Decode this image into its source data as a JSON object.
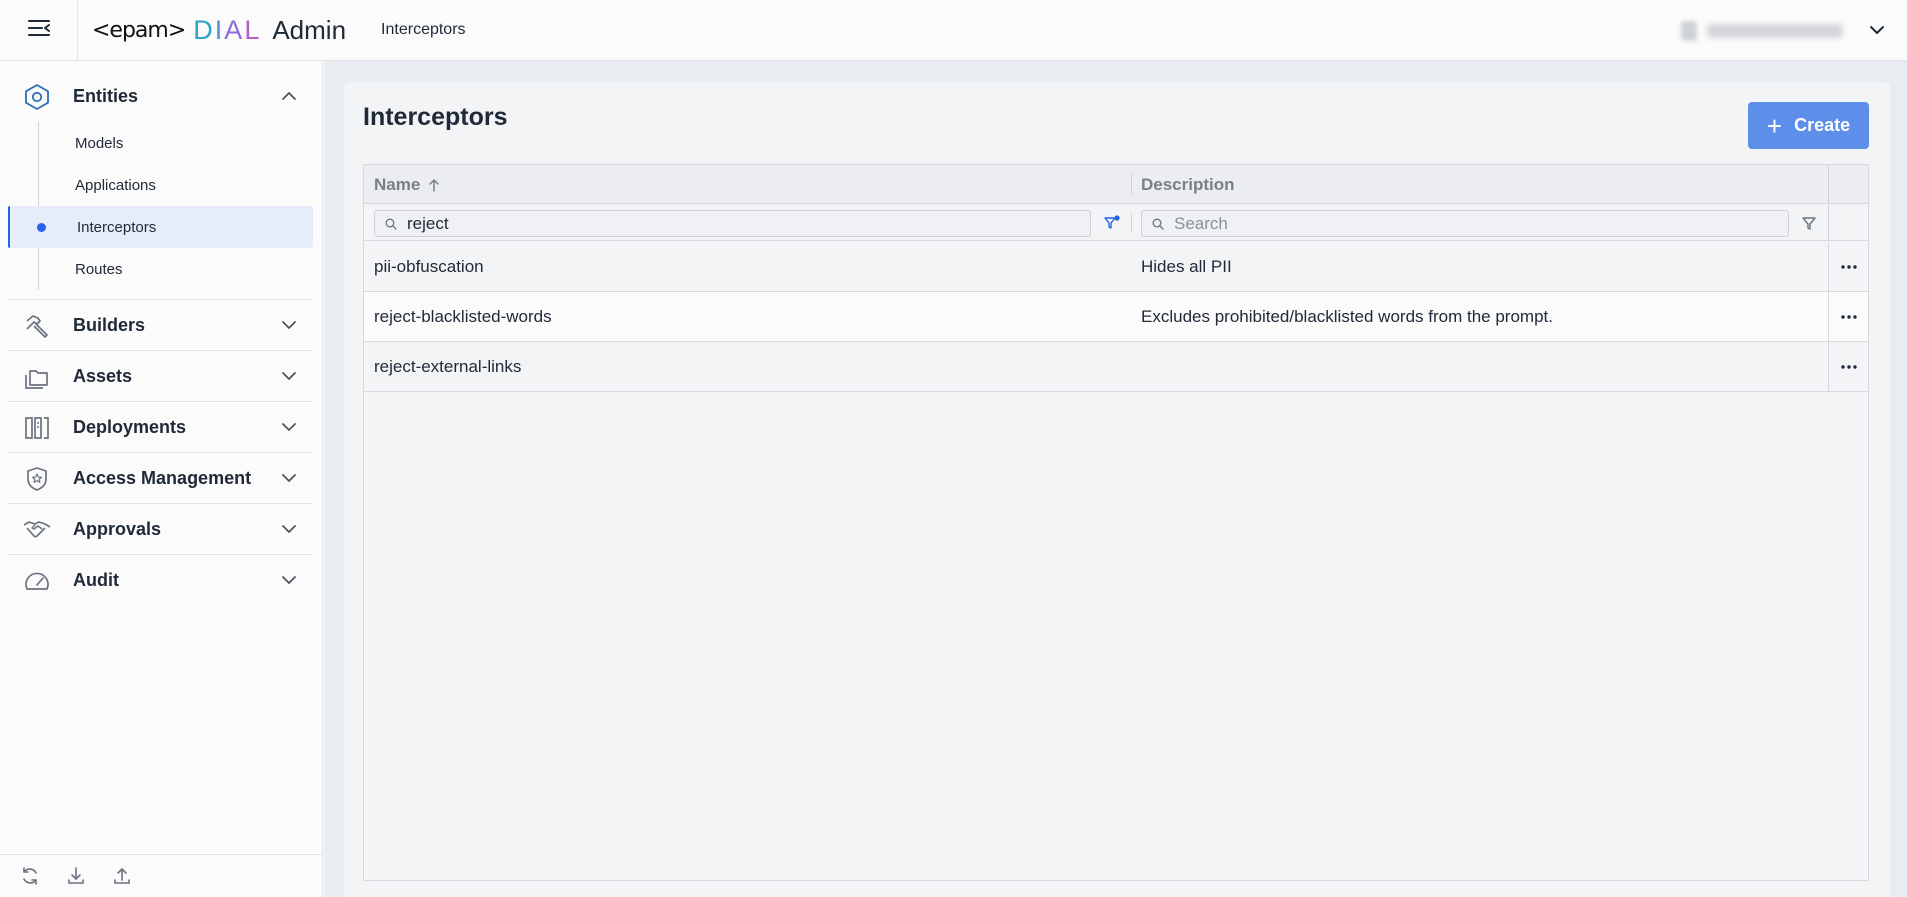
{
  "app": {
    "logo_epam": "<epam>",
    "logo_dial": [
      "D",
      "I",
      "A",
      "L"
    ],
    "logo_admin": "Admin",
    "header_title": "Interceptors"
  },
  "sidebar": {
    "groups": [
      {
        "label": "Entities",
        "icon": "hexagon-icon",
        "expanded": true,
        "items": [
          {
            "label": "Models",
            "active": false
          },
          {
            "label": "Applications",
            "active": false
          },
          {
            "label": "Interceptors",
            "active": true
          },
          {
            "label": "Routes",
            "active": false
          }
        ]
      },
      {
        "label": "Builders",
        "icon": "hammer-icon",
        "expanded": false
      },
      {
        "label": "Assets",
        "icon": "folders-icon",
        "expanded": false
      },
      {
        "label": "Deployments",
        "icon": "deployments-icon",
        "expanded": false
      },
      {
        "label": "Access Management",
        "icon": "shield-star-icon",
        "expanded": false
      },
      {
        "label": "Approvals",
        "icon": "handshake-icon",
        "expanded": false
      },
      {
        "label": "Audit",
        "icon": "gauge-icon",
        "expanded": false
      }
    ],
    "bottom_icons": [
      "refresh-icon",
      "download-icon",
      "upload-icon"
    ]
  },
  "main": {
    "title": "Interceptors",
    "create_label": "Create",
    "columns": [
      {
        "label": "Name",
        "sort": "asc"
      },
      {
        "label": "Description"
      }
    ],
    "filters": {
      "name_value": "reject",
      "description_placeholder": "Search"
    },
    "rows": [
      {
        "name": "pii-obfuscation",
        "description": "Hides all PII"
      },
      {
        "name": "reject-blacklisted-words",
        "description": "Excludes prohibited/blacklisted words from the prompt."
      },
      {
        "name": "reject-external-links",
        "description": ""
      }
    ]
  },
  "colors": {
    "accent": "#2563eb",
    "create_button": "#5d8fea",
    "active_nav_bg": "#e6ecf9"
  }
}
